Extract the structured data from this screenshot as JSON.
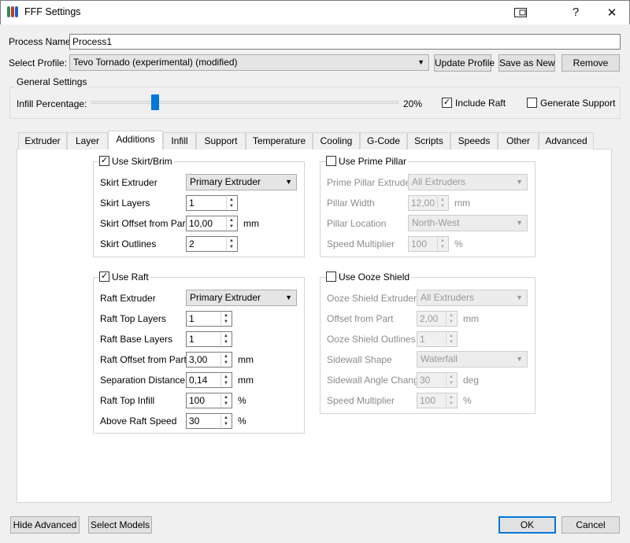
{
  "window": {
    "title": "FFF Settings",
    "help_glyph": "?",
    "close_glyph": "✕",
    "icon_colors": [
      "#2e8b57",
      "#c0392b",
      "#1f5fbf"
    ]
  },
  "process": {
    "name_label": "Process Name:",
    "name_value": "Process1",
    "profile_label": "Select Profile:",
    "profile_value": "Tevo Tornado (experimental) (modified)",
    "update_profile": "Update Profile",
    "save_as_new": "Save as New",
    "remove": "Remove"
  },
  "general": {
    "title": "General Settings",
    "infill_label": "Infill Percentage:",
    "infill_value": "20%",
    "infill_fraction": 0.2,
    "include_raft": "Include Raft",
    "include_raft_checked": true,
    "generate_support": "Generate Support",
    "generate_support_checked": false
  },
  "tabs": [
    "Extruder",
    "Layer",
    "Additions",
    "Infill",
    "Support",
    "Temperature",
    "Cooling",
    "G-Code",
    "Scripts",
    "Speeds",
    "Other",
    "Advanced"
  ],
  "active_tab": "Additions",
  "skirt": {
    "title": "Use Skirt/Brim",
    "checked": true,
    "extruder_label": "Skirt Extruder",
    "extruder_value": "Primary Extruder",
    "layers_label": "Skirt Layers",
    "layers_value": "1",
    "offset_label": "Skirt Offset from Part",
    "offset_value": "10,00",
    "offset_unit": "mm",
    "outlines_label": "Skirt Outlines",
    "outlines_value": "2"
  },
  "raft": {
    "title": "Use Raft",
    "checked": true,
    "extruder_label": "Raft Extruder",
    "extruder_value": "Primary Extruder",
    "top_layers_label": "Raft Top Layers",
    "top_layers_value": "1",
    "base_layers_label": "Raft Base Layers",
    "base_layers_value": "1",
    "offset_label": "Raft Offset from Part",
    "offset_value": "3,00",
    "offset_unit": "mm",
    "separation_label": "Separation Distance",
    "separation_value": "0,14",
    "separation_unit": "mm",
    "top_infill_label": "Raft Top Infill",
    "top_infill_value": "100",
    "top_infill_unit": "%",
    "speed_label": "Above Raft Speed",
    "speed_value": "30",
    "speed_unit": "%"
  },
  "prime": {
    "title": "Use Prime Pillar",
    "checked": false,
    "extruder_label": "Prime Pillar Extruder",
    "extruder_value": "All Extruders",
    "width_label": "Pillar Width",
    "width_value": "12,00",
    "width_unit": "mm",
    "location_label": "Pillar Location",
    "location_value": "North-West",
    "speed_label": "Speed Multiplier",
    "speed_value": "100",
    "speed_unit": "%"
  },
  "ooze": {
    "title": "Use Ooze Shield",
    "checked": false,
    "extruder_label": "Ooze Shield Extruder",
    "extruder_value": "All Extruders",
    "offset_label": "Offset from Part",
    "offset_value": "2,00",
    "offset_unit": "mm",
    "outlines_label": "Ooze Shield Outlines",
    "outlines_value": "1",
    "sidewall_shape_label": "Sidewall Shape",
    "sidewall_shape_value": "Waterfall",
    "sidewall_angle_label": "Sidewall Angle Change",
    "sidewall_angle_value": "30",
    "sidewall_angle_unit": "deg",
    "speed_label": "Speed Multiplier",
    "speed_value": "100",
    "speed_unit": "%"
  },
  "footer": {
    "hide_advanced": "Hide Advanced",
    "select_models": "Select Models",
    "ok": "OK",
    "cancel": "Cancel"
  }
}
